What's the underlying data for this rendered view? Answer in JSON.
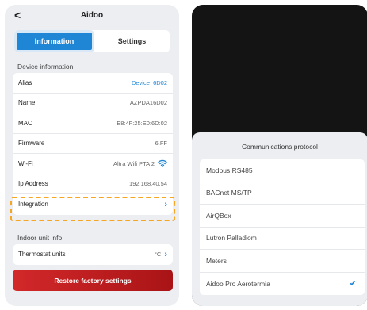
{
  "left": {
    "back_glyph": "<",
    "title": "Aidoo",
    "tabs": [
      {
        "label": "Information",
        "active": true
      },
      {
        "label": "Settings",
        "active": false
      }
    ],
    "device_section_label": "Device information",
    "device_rows": [
      {
        "label": "Alias",
        "value": "Device_6D02"
      },
      {
        "label": "Name",
        "value": "AZPDA16D02"
      },
      {
        "label": "MAC",
        "value": "E8:4F:25:E0:6D:02"
      },
      {
        "label": "Firmware",
        "value": "6.FF"
      },
      {
        "label": "Wi-Fi",
        "value": "Altra Wifi PTA 2"
      },
      {
        "label": "Ip Address",
        "value": "192.168.40.54"
      },
      {
        "label": "Integration",
        "value": ""
      }
    ],
    "indoor_section_label": "Indoor unit info",
    "indoor_rows": [
      {
        "label": "Thermostat units",
        "value": "°C"
      }
    ],
    "restore_label": "Restore factory settings"
  },
  "right": {
    "sheet_title": "Communications protocol",
    "options": [
      {
        "label": "Modbus RS485",
        "selected": false
      },
      {
        "label": "BACnet MS/TP",
        "selected": false
      },
      {
        "label": "AirQBox",
        "selected": false
      },
      {
        "label": "Lutron Palladiom",
        "selected": false
      },
      {
        "label": "Meters",
        "selected": false
      },
      {
        "label": "Aidoo Pro Aerotermia",
        "selected": true
      }
    ]
  },
  "colors": {
    "accent": "#1f86d6",
    "highlight": "#f5a623",
    "danger": "#c8201f"
  },
  "icons": {
    "wifi": "wifi-icon",
    "chevron": "chevron-right-icon",
    "check": "checkmark-icon",
    "back": "back-arrow-icon"
  }
}
